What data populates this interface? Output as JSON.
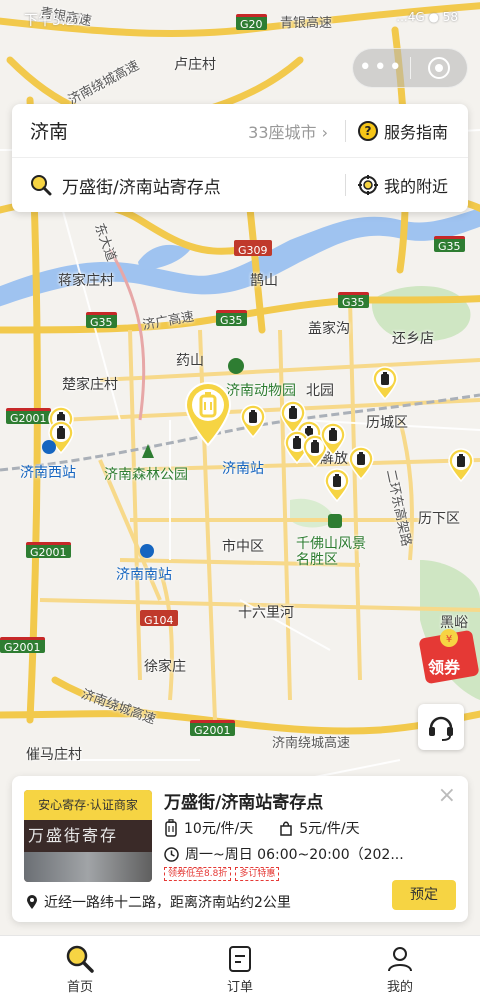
{
  "status_bar": {
    "time": "下午5:27",
    "right": "...4G ● 58"
  },
  "search": {
    "city": "济南",
    "city_count": "33座城市 ›",
    "guide_label": "服务指南",
    "query": "万盛街/济南站寄存点",
    "nearby_label": "我的附近"
  },
  "map": {
    "labels": {
      "qingyin_top": "青银高速",
      "qingyin_top2": "青银高速",
      "luzhuangcun": "卢庄村",
      "jinanraocheng_top": "济南绕城高速",
      "dongdadao": "东大道",
      "jiangjiazhuang": "蒋家庄村",
      "queshan": "鹊山",
      "jiguang": "济广高速",
      "gaijiagou": "盖家沟",
      "huanxiangdian": "还乡店",
      "yaoshan": "药山",
      "dongwuyuan": "济南动物园",
      "chujiazhuang": "楚家庄村",
      "beiyuan": "北园",
      "lichengqu": "历城区",
      "jiefang": "解放",
      "jinanxizhan": "济南西站",
      "senlingongyuan": "济南森林公园",
      "jinanzhan": "济南站",
      "erhuan": "二环东高架路",
      "lixiaqu": "历下区",
      "shizhongqu": "市中区",
      "qianfoshan": "千佛山风景名胜区",
      "jinannanzhan": "济南南站",
      "shiliuli": "十六里河",
      "xujiazhuang": "徐家庄",
      "raocheng_bottom": "济南绕城高速",
      "raocheng_bottom2": "济南绕城高速",
      "raocheng_left": "济南绕城高速",
      "cuimazhuang": "催马庄村",
      "heiyu": "黑峪"
    },
    "shields": {
      "g20": "G20",
      "g309": "G309",
      "g35a": "G35",
      "g35b": "G35",
      "g35c": "G35",
      "g35d": "G35",
      "g2001a": "G2001",
      "g2001b": "G2001",
      "g2001c": "G2001",
      "g2001d": "G2001",
      "g104": "G104"
    }
  },
  "coupon_label": "领券",
  "store": {
    "badge": "安心寄存·认证商家",
    "sign_text": "万盛街寄存",
    "name": "万盛街/济南站寄存点",
    "price_large": "10元/件/天",
    "price_small": "5元/件/天",
    "hours": "周一~周日 06:00~20:00（202...",
    "tag1": "领券低至8.8折",
    "tag2": "多订特惠",
    "address": "近经一路纬十二路，距离济南站约2公里",
    "book_label": "预定",
    "close_label": "×"
  },
  "tabs": [
    {
      "label": "首页"
    },
    {
      "label": "订单"
    },
    {
      "label": "我的"
    }
  ],
  "colors": {
    "brand_yellow": "#f6d443",
    "map_bg": "#f4f2ee",
    "water": "#9fc3f0",
    "park": "#cfe6c3"
  }
}
